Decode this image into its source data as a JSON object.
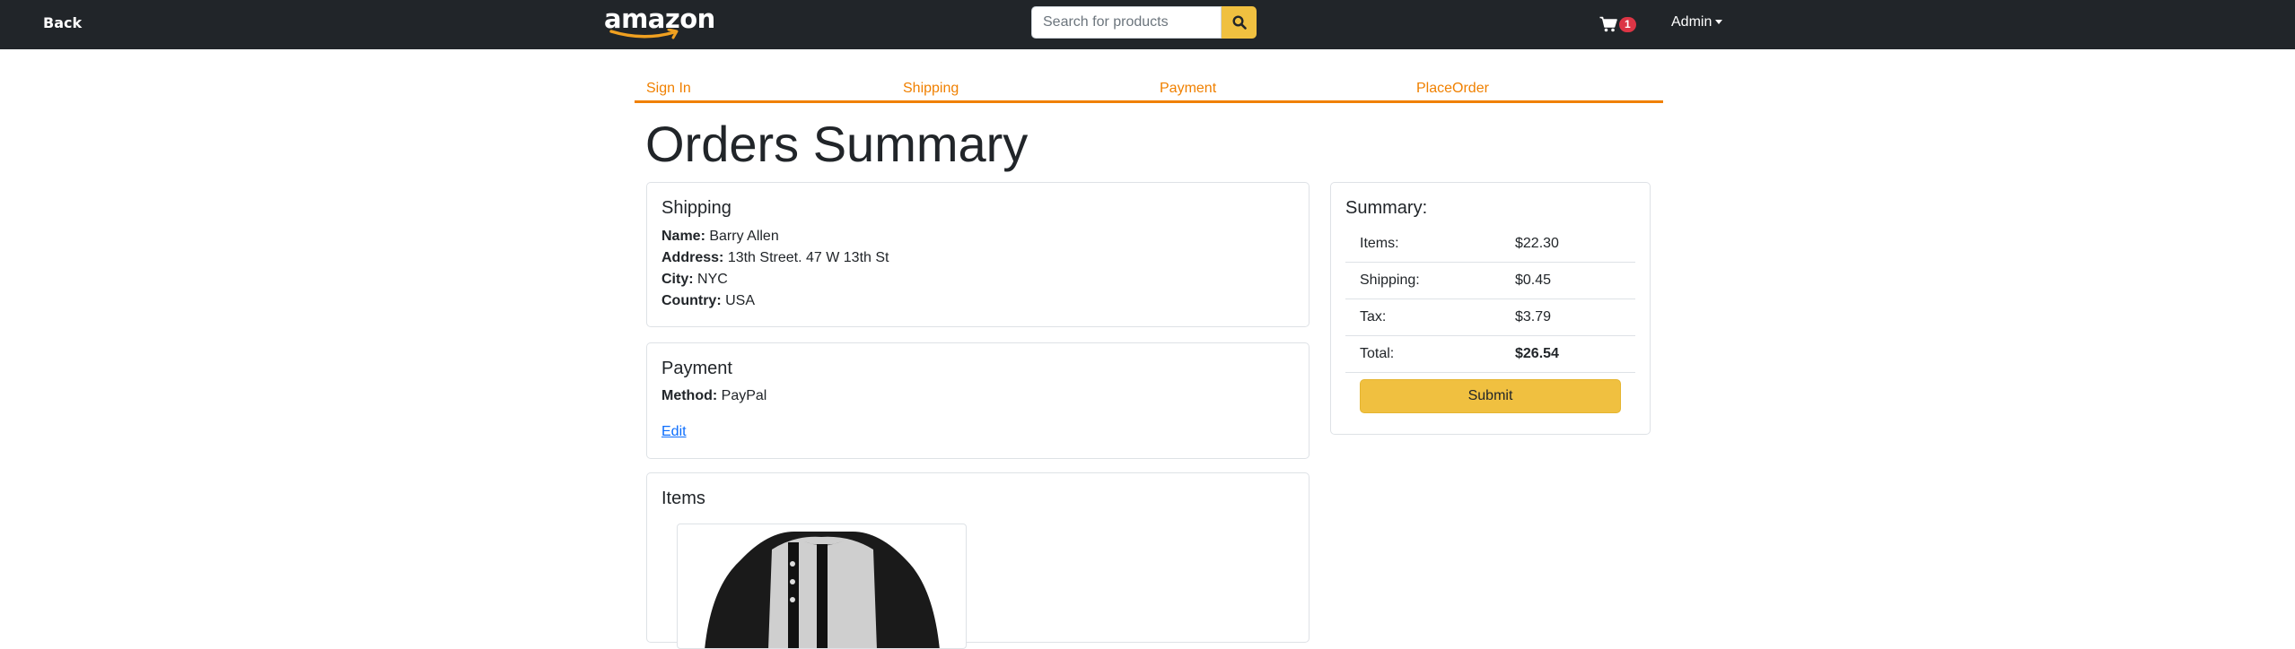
{
  "nav": {
    "back_label": "Back",
    "brand": "amazon",
    "search_placeholder": "Search for products",
    "cart_count": "1",
    "user_label": "Admin"
  },
  "steps": [
    "Sign In",
    "Shipping",
    "Payment",
    "PlaceOrder"
  ],
  "page_title": "Orders Summary",
  "shipping": {
    "title": "Shipping",
    "name_label": "Name:",
    "name": "Barry Allen",
    "address_label": "Address:",
    "address": "13th Street. 47 W 13th St",
    "city_label": "City:",
    "city": "NYC",
    "country_label": "Country:",
    "country": "USA"
  },
  "payment": {
    "title": "Payment",
    "method_label": "Method:",
    "method": "PayPal",
    "edit_label": "Edit"
  },
  "items": {
    "title": "Items"
  },
  "summary": {
    "title": "Summary:",
    "rows": [
      {
        "label": "Items:",
        "value": "$22.30"
      },
      {
        "label": "Shipping:",
        "value": "$0.45"
      },
      {
        "label": "Tax:",
        "value": "$3.79"
      },
      {
        "label": "Total:",
        "value": "$26.54"
      }
    ],
    "submit_label": "Submit"
  },
  "colors": {
    "navbar_bg": "#212529",
    "accent_orange": "#f08000",
    "button_yellow": "#f0c040",
    "badge_red": "#dc3545",
    "link_blue": "#0d6efd"
  }
}
